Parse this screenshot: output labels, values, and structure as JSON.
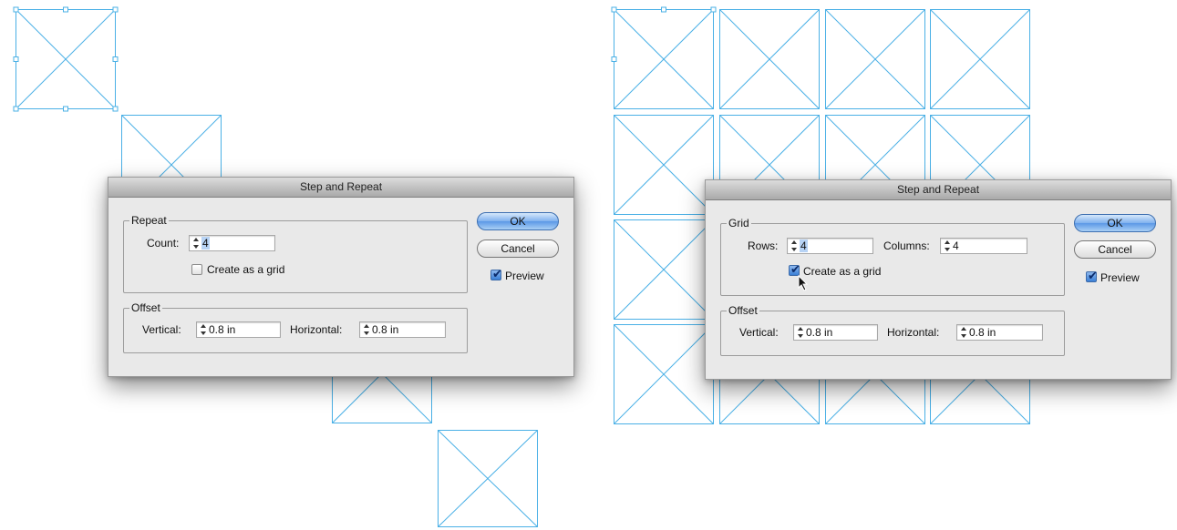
{
  "dialogs": [
    {
      "title": "Step and Repeat",
      "group_label": "Repeat",
      "fields": [
        {
          "label": "Count:",
          "value": "4"
        }
      ],
      "grid_checkbox": {
        "label": "Create as a grid",
        "checked": false
      },
      "offset": {
        "label": "Offset",
        "vertical_label": "Vertical:",
        "vertical_value": "0.8 in",
        "horizontal_label": "Horizontal:",
        "horizontal_value": "0.8 in"
      },
      "ok_label": "OK",
      "cancel_label": "Cancel",
      "preview": {
        "label": "Preview",
        "checked": true
      }
    },
    {
      "title": "Step and Repeat",
      "group_label": "Grid",
      "fields": [
        {
          "label": "Rows:",
          "value": "4"
        },
        {
          "label": "Columns:",
          "value": "4"
        }
      ],
      "grid_checkbox": {
        "label": "Create as a grid",
        "checked": true
      },
      "offset": {
        "label": "Offset",
        "vertical_label": "Vertical:",
        "vertical_value": "0.8 in",
        "horizontal_label": "Horizontal:",
        "horizontal_value": "0.8 in"
      },
      "ok_label": "OK",
      "cancel_label": "Cancel",
      "preview": {
        "label": "Preview",
        "checked": true
      }
    }
  ],
  "colors": {
    "frame_stroke": "#4ab0e6",
    "dialog_bg": "#e9e9e9",
    "selection": "#b7d3f5"
  },
  "icons": {
    "stepper": "stepper-arrows-icon",
    "checkmark": "checkmark-icon",
    "cursor": "mouse-pointer-icon"
  }
}
